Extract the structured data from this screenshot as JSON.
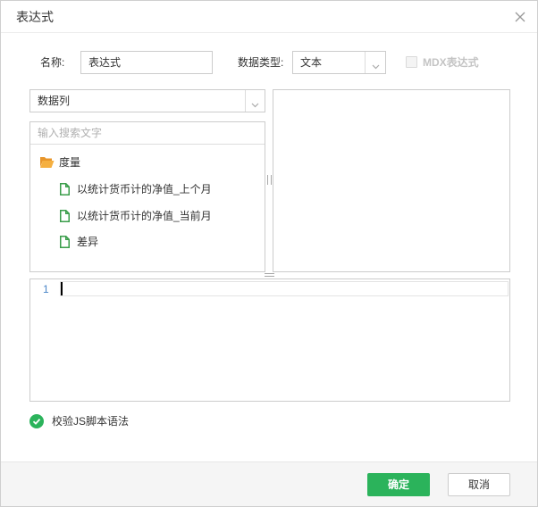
{
  "dialog": {
    "title": "表达式",
    "close_icon": "close-icon"
  },
  "form": {
    "name_label": "名称:",
    "name_value": "表达式",
    "type_label": "数据类型:",
    "type_value": "文本",
    "mdx_label": "MDX表达式",
    "mdx_checked": false,
    "mdx_disabled": true
  },
  "left_panel": {
    "source_select": "数据列",
    "search_placeholder": "输入搜索文字",
    "tree": {
      "folder": {
        "label": "度量",
        "icon": "folder-icon"
      },
      "items": [
        {
          "label": "以统计货币计的净值_上个月",
          "icon": "file-icon"
        },
        {
          "label": "以统计货币计的净值_当前月",
          "icon": "file-icon"
        },
        {
          "label": "差异",
          "icon": "file-icon"
        }
      ]
    }
  },
  "editor": {
    "line_numbers": [
      "1"
    ]
  },
  "validate": {
    "label": "校验JS脚本语法",
    "icon": "check-circle-icon"
  },
  "footer": {
    "ok_label": "确定",
    "cancel_label": "取消"
  },
  "colors": {
    "accent": "#2bb35b",
    "folder": "#f2a33a",
    "file": "#3a9d4a",
    "line_number": "#4a86c8",
    "disabled_text": "#c4c4c4"
  }
}
